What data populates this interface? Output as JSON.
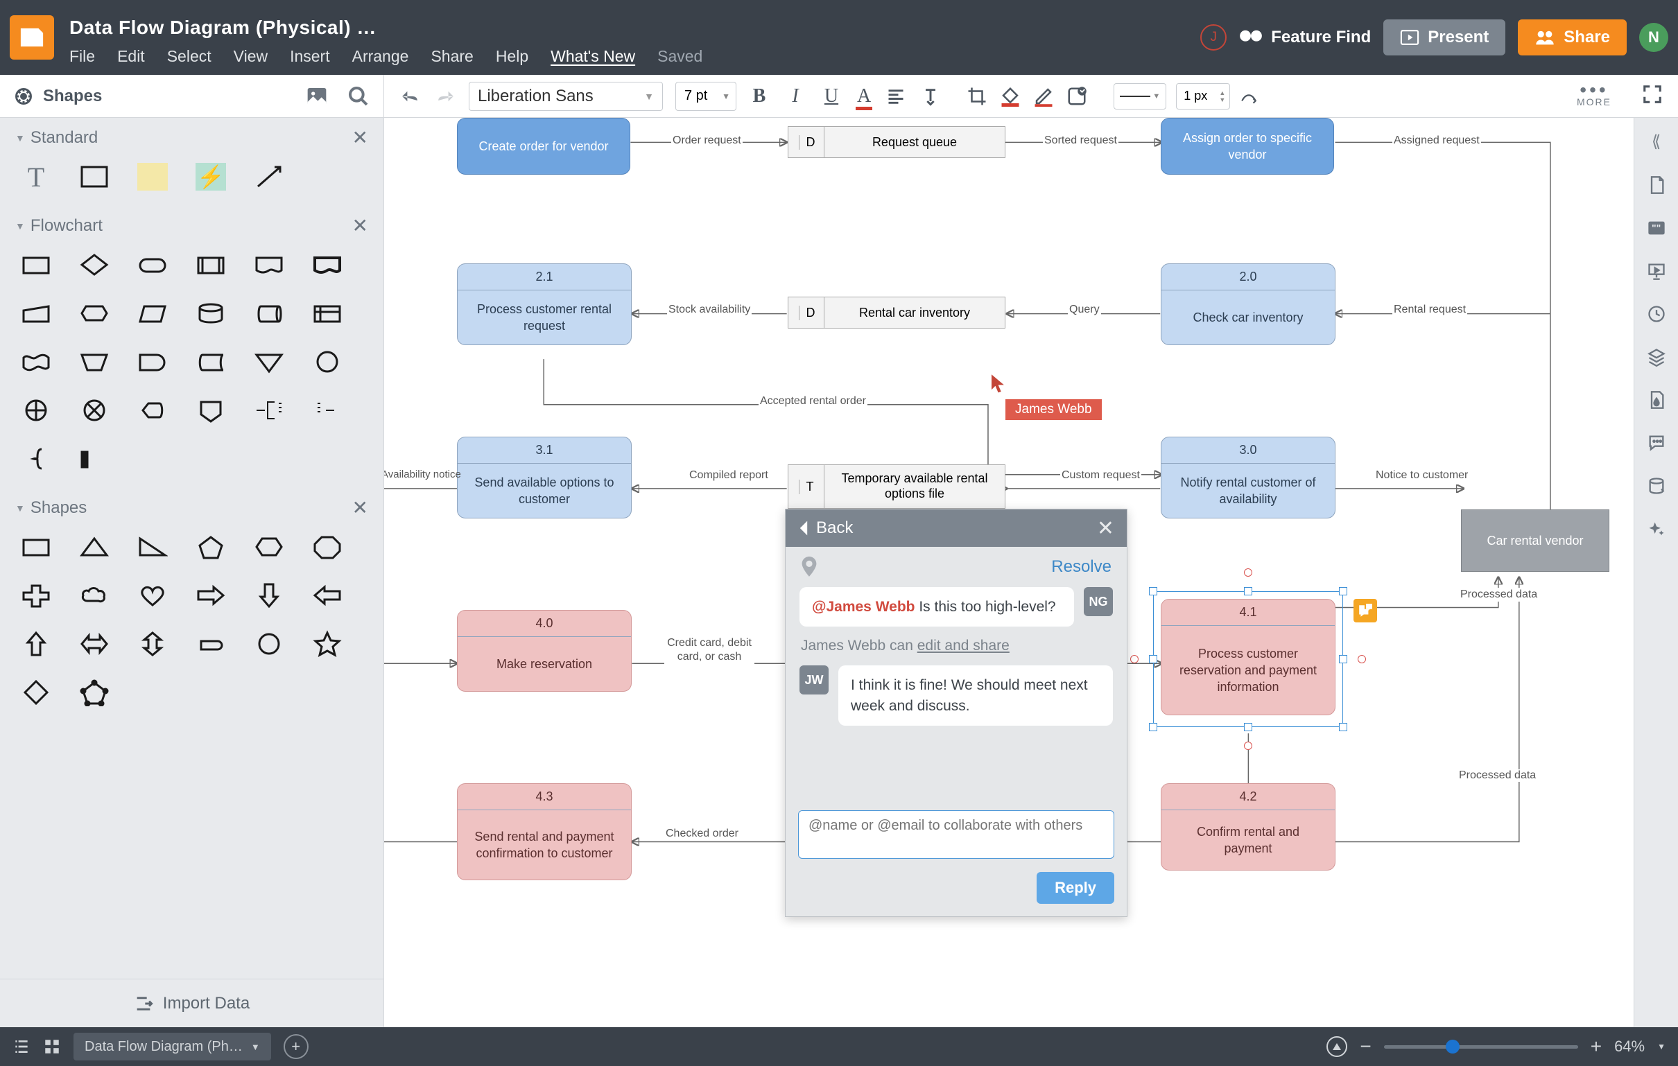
{
  "header": {
    "title": "Data Flow Diagram (Physical) …",
    "menus": [
      "File",
      "Edit",
      "Select",
      "View",
      "Insert",
      "Arrange",
      "Share",
      "Help"
    ],
    "whatsnew": "What's New",
    "saved": "Saved",
    "feature_find": "Feature Find",
    "present": "Present",
    "share": "Share",
    "avatar_left": "J",
    "avatar_right": "N"
  },
  "toolbar": {
    "shapes_label": "Shapes",
    "font": "Liberation Sans",
    "font_size": "7 pt",
    "line_width": "1 px",
    "more": "MORE"
  },
  "left_panel": {
    "sections": {
      "standard": "Standard",
      "flowchart": "Flowchart",
      "shapes": "Shapes"
    },
    "import_data": "Import Data"
  },
  "canvas": {
    "remote_user": "James Webb",
    "processes": {
      "p1": {
        "id": "",
        "text": "Create order for vendor"
      },
      "p2": {
        "id": "",
        "text": "Assign order to specific vendor"
      },
      "p21": {
        "id": "2.1",
        "text": "Process customer rental request"
      },
      "p20": {
        "id": "2.0",
        "text": "Check car inventory"
      },
      "p31": {
        "id": "3.1",
        "text": "Send available options to customer"
      },
      "p30": {
        "id": "3.0",
        "text": "Notify rental customer of availability"
      },
      "p40": {
        "id": "4.0",
        "text": "Make reservation"
      },
      "p41": {
        "id": "4.1",
        "text": "Process customer reservation and payment information"
      },
      "p43": {
        "id": "4.3",
        "text": "Send rental and payment confirmation to customer"
      },
      "p42": {
        "id": "4.2",
        "text": "Confirm rental and payment"
      }
    },
    "datastores": {
      "d1": {
        "letter": "D",
        "label": "Request queue"
      },
      "d2": {
        "letter": "D",
        "label": "Rental car inventory"
      },
      "t1": {
        "letter": "T",
        "label": "Temporary available rental options file"
      }
    },
    "external": {
      "label": "Car rental vendor"
    },
    "edge_labels": {
      "order_request": "Order request",
      "sorted_request": "Sorted request",
      "assigned_request": "Assigned request",
      "stock_availability": "Stock availability",
      "query": "Query",
      "rental_request": "Rental request",
      "accepted_rental": "Accepted rental order",
      "compiled_report": "Compiled report",
      "custom_request": "Custom request",
      "notice_customer": "Notice to customer",
      "availability_notice": "Availability notice",
      "credit": "Credit card, debit card, or cash",
      "checked_order": "Checked order",
      "processed_data_top": "Processed data",
      "processed_data_bottom": "Processed data"
    }
  },
  "comments": {
    "back": "Back",
    "resolve": "Resolve",
    "c1": {
      "avatar": "NG",
      "mention": "@James Webb",
      "text": "Is this too high-level?"
    },
    "share_note_name": "James Webb",
    "share_note_action": "can",
    "share_note_link": "edit and share",
    "c2": {
      "avatar": "JW",
      "text": "I think it is fine! We should meet next week and discuss."
    },
    "reply_placeholder": "@name or @email to collaborate with others",
    "reply_btn": "Reply"
  },
  "footer": {
    "page_name": "Data Flow Diagram (Ph…",
    "zoom": "64%"
  }
}
